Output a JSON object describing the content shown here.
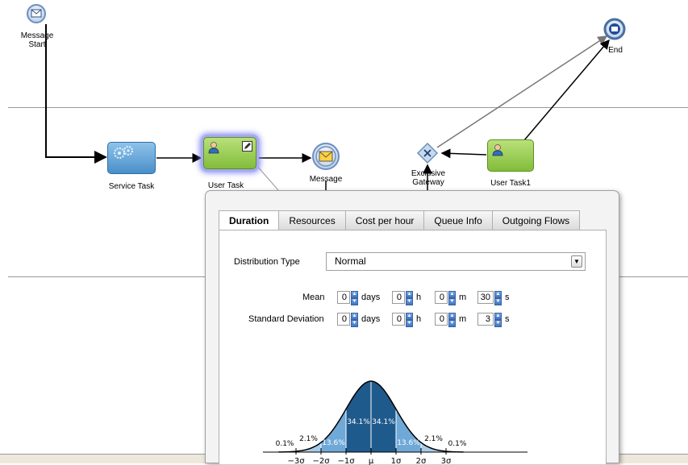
{
  "diagram": {
    "nodes": {
      "message_start": "Message\nStart",
      "service_task": "Service Task",
      "user_task": "User Task",
      "message": "Message",
      "exclusive_gateway": "Exclusive\nGateway",
      "user_task1": "User Task1",
      "end": "End"
    }
  },
  "panel": {
    "tabs": [
      {
        "label": "Duration",
        "active": true
      },
      {
        "label": "Resources",
        "active": false
      },
      {
        "label": "Cost per hour",
        "active": false
      },
      {
        "label": "Queue Info",
        "active": false
      },
      {
        "label": "Outgoing Flows",
        "active": false
      }
    ],
    "distribution_type_label": "Distribution Type",
    "distribution_type_value": "Normal",
    "mean": {
      "label": "Mean",
      "days": "0",
      "h": "0",
      "m": "0",
      "s": "30"
    },
    "std_dev": {
      "label": "Standard Deviation",
      "days": "0",
      "h": "0",
      "m": "0",
      "s": "3"
    },
    "units": {
      "days": "days",
      "h": "h",
      "m": "m",
      "s": "s"
    },
    "colors": {
      "dark": "#1f5a8c",
      "mid": "#3a7fbd",
      "light": "#6fa9d8",
      "lightest": "#a8cbe9"
    }
  },
  "chart_data": {
    "type": "area",
    "title": "",
    "xlabel": "",
    "ylabel": "",
    "x_ticks": [
      "−3σ",
      "−2σ",
      "−1σ",
      "μ",
      "1σ",
      "2σ",
      "3σ"
    ],
    "regions": [
      {
        "range": [
          "-4",
          "-3"
        ],
        "percent": "0.1%"
      },
      {
        "range": [
          "-3",
          "-2"
        ],
        "percent": "2.1%"
      },
      {
        "range": [
          "-2",
          "-1"
        ],
        "percent": "13.6%"
      },
      {
        "range": [
          "-1",
          "0"
        ],
        "percent": "34.1%"
      },
      {
        "range": [
          "0",
          "1"
        ],
        "percent": "34.1%"
      },
      {
        "range": [
          "1",
          "2"
        ],
        "percent": "13.6%"
      },
      {
        "range": [
          "2",
          "3"
        ],
        "percent": "2.1%"
      },
      {
        "range": [
          "3",
          "4"
        ],
        "percent": "0.1%"
      }
    ],
    "xlim": [
      -3.7,
      3.7
    ]
  }
}
